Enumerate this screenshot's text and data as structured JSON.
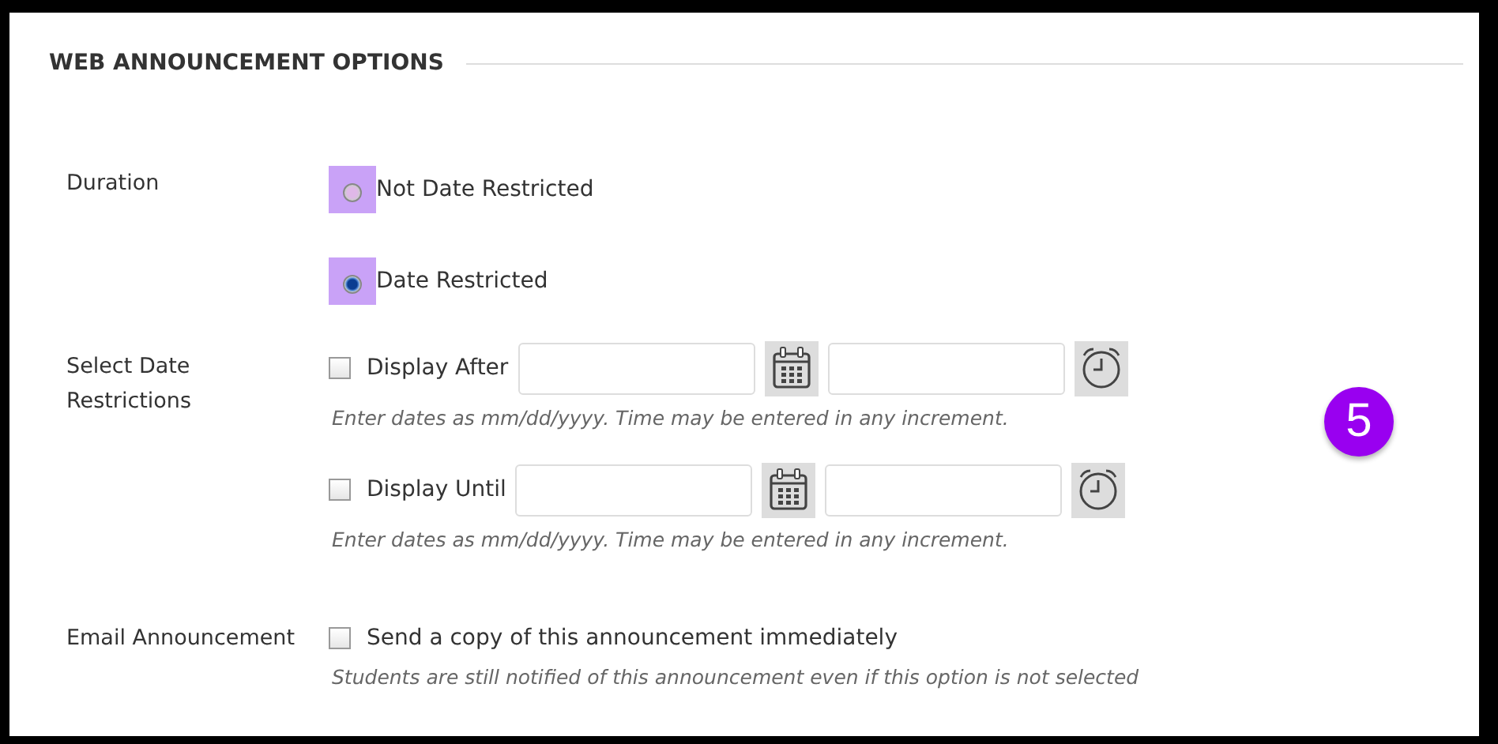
{
  "section": {
    "title": "WEB ANNOUNCEMENT OPTIONS"
  },
  "duration": {
    "label": "Duration",
    "options": [
      {
        "label": "Not Date Restricted",
        "selected": false
      },
      {
        "label": "Date Restricted",
        "selected": true
      }
    ]
  },
  "date_restrictions": {
    "label": "Select Date Restrictions",
    "rows": [
      {
        "label": "Display After",
        "checked": false,
        "hint": "Enter dates as mm/dd/yyyy. Time may be entered in any increment."
      },
      {
        "label": "Display Until",
        "checked": false,
        "hint": "Enter dates as mm/dd/yyyy. Time may be entered in any increment."
      }
    ]
  },
  "email": {
    "label": "Email Announcement",
    "option": {
      "label": "Send a copy of this announcement immediately",
      "checked": false
    },
    "hint": "Students are still notified of this announcement even if this option is not selected"
  },
  "callout": {
    "number": "5"
  }
}
